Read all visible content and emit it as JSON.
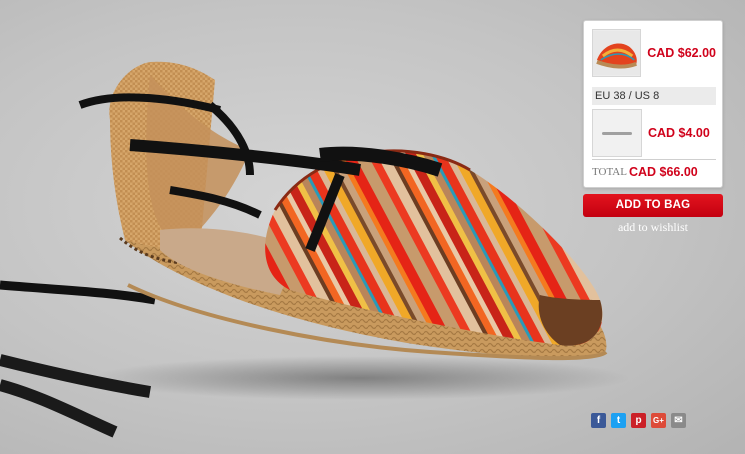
{
  "cart": {
    "items": [
      {
        "price": "CAD $62.00",
        "thumbnail": "espadrille-thumbnail"
      },
      {
        "price": "CAD $4.00",
        "thumbnail": "placeholder-thumbnail"
      }
    ],
    "size": "EU 38 / US 8",
    "total_label": "TOTAL",
    "total_value": "CAD $66.00"
  },
  "actions": {
    "add_to_bag": "ADD TO BAG",
    "add_to_wishlist": "add to wishlist"
  },
  "share": [
    {
      "icon": "facebook-icon",
      "glyph": "f",
      "color": "#3b5998"
    },
    {
      "icon": "twitter-icon",
      "glyph": "t",
      "color": "#1da1f2"
    },
    {
      "icon": "pinterest-icon",
      "glyph": "p",
      "color": "#cb2027"
    },
    {
      "icon": "google-plus-icon",
      "glyph": "G+",
      "color": "#dd4b39"
    },
    {
      "icon": "email-icon",
      "glyph": "✉",
      "color": "#8a8a8a"
    }
  ],
  "colors": {
    "accent_red": "#d0021b",
    "button_red": "#e3141e"
  }
}
